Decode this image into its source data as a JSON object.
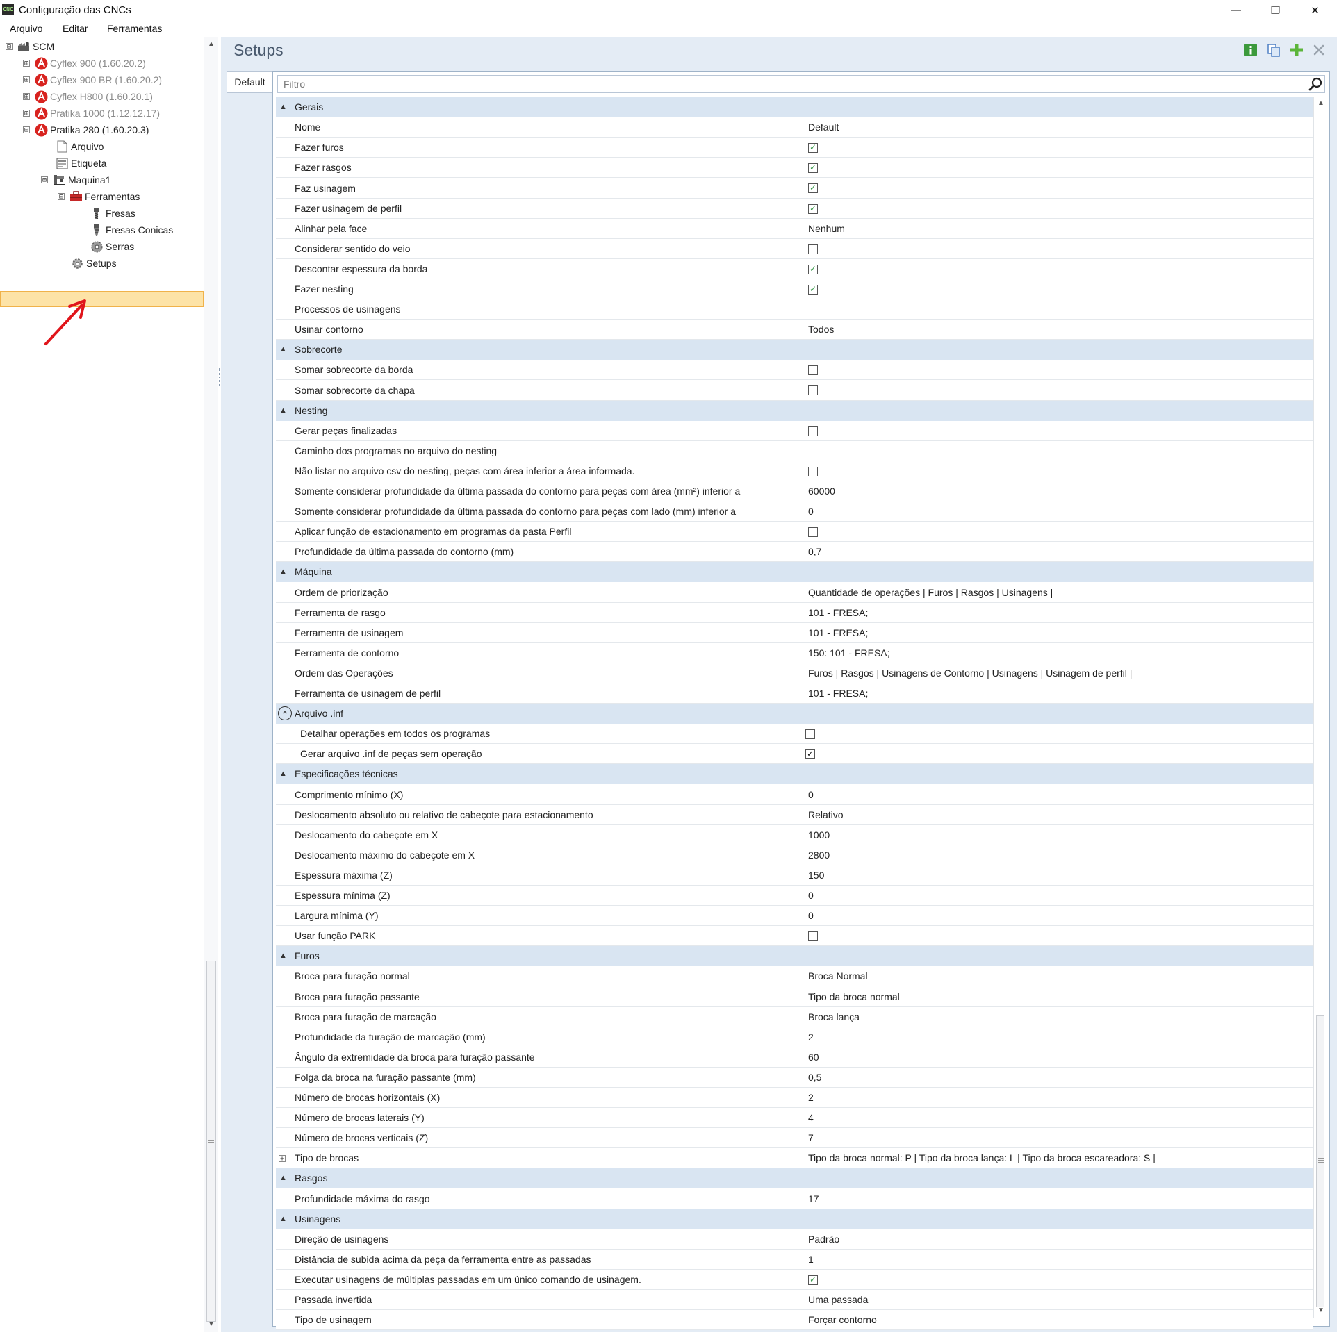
{
  "window": {
    "title": "Configuração das CNCs",
    "app_icon_text": "CNC",
    "minimize": "—",
    "restore": "❐",
    "close": "✕"
  },
  "menu": [
    "Arquivo",
    "Editar",
    "Ferramentas"
  ],
  "tree": [
    {
      "label": "SCM",
      "expander": "⊟",
      "icon": "factory-icon",
      "dim": false
    },
    {
      "label": "Cyflex 900 (1.60.20.2)",
      "expander": "⊞",
      "icon": "scm-logo-icon",
      "dim": true
    },
    {
      "label": "Cyflex 900 BR (1.60.20.2)",
      "expander": "⊞",
      "icon": "scm-logo-icon",
      "dim": true
    },
    {
      "label": "Cyflex H800 (1.60.20.1)",
      "expander": "⊞",
      "icon": "scm-logo-icon",
      "dim": true
    },
    {
      "label": "Pratika 1000 (1.12.12.17)",
      "expander": "⊞",
      "icon": "scm-logo-icon",
      "dim": true
    },
    {
      "label": "Pratika 280 (1.60.20.3)",
      "expander": "⊟",
      "icon": "scm-logo-icon",
      "dim": false
    },
    {
      "label": "Arquivo",
      "expander": "",
      "icon": "file-icon",
      "dim": false
    },
    {
      "label": "Etiqueta",
      "expander": "",
      "icon": "label-icon",
      "dim": false
    },
    {
      "label": "Maquina1",
      "expander": "⊟",
      "icon": "machine-icon",
      "dim": false
    },
    {
      "label": "Ferramentas",
      "expander": "⊟",
      "icon": "toolbox-icon",
      "dim": false
    },
    {
      "label": "Fresas",
      "expander": "",
      "icon": "mill-icon",
      "dim": false
    },
    {
      "label": "Fresas Conicas",
      "expander": "",
      "icon": "conic-mill-icon",
      "dim": false
    },
    {
      "label": "Serras",
      "expander": "",
      "icon": "saw-icon",
      "dim": false
    },
    {
      "label": "Setups",
      "expander": "",
      "icon": "gear-icon",
      "dim": false
    }
  ],
  "panel": {
    "title": "Setups",
    "tab": "Default",
    "filter_placeholder": "Filtro"
  },
  "colors": {
    "accent_selection": "#fde3a7",
    "category_bg": "#d9e5f2",
    "panel_bg": "#e4ecf5",
    "checkbox_tick": "#3a9a4a"
  },
  "grid": [
    {
      "type": "cat",
      "label": "Gerais",
      "toggle": "▲"
    },
    {
      "type": "prop",
      "name": "Nome",
      "value": "Default"
    },
    {
      "type": "prop",
      "name": "Fazer furos",
      "check": true
    },
    {
      "type": "prop",
      "name": "Fazer rasgos",
      "check": true
    },
    {
      "type": "prop",
      "name": "Faz usinagem",
      "check": true
    },
    {
      "type": "prop",
      "name": "Fazer usinagem de perfil",
      "check": true
    },
    {
      "type": "prop",
      "name": "Alinhar pela face",
      "value": "Nenhum"
    },
    {
      "type": "prop",
      "name": "Considerar sentido do veio",
      "check": false
    },
    {
      "type": "prop",
      "name": "Descontar espessura da borda",
      "check": true
    },
    {
      "type": "prop",
      "name": "Fazer nesting",
      "check": true
    },
    {
      "type": "prop",
      "name": "Processos de usinagens",
      "value": ""
    },
    {
      "type": "prop",
      "name": "Usinar contorno",
      "value": "Todos"
    },
    {
      "type": "cat",
      "label": "Sobrecorte",
      "toggle": "▲"
    },
    {
      "type": "prop",
      "name": "Somar sobrecorte da borda",
      "check": false
    },
    {
      "type": "prop",
      "name": "Somar sobrecorte da chapa",
      "check": false
    },
    {
      "type": "cat",
      "label": "Nesting",
      "toggle": "▲"
    },
    {
      "type": "prop",
      "name": "Gerar peças finalizadas",
      "check": false
    },
    {
      "type": "prop",
      "name": "Caminho dos programas no arquivo do nesting",
      "value": ""
    },
    {
      "type": "prop",
      "name": "Não listar no arquivo csv do nesting, peças com área inferior a área informada.",
      "check": false
    },
    {
      "type": "prop",
      "name": "Somente considerar profundidade da última passada do contorno para peças com área (mm²) inferior a",
      "value": "60000"
    },
    {
      "type": "prop",
      "name": "Somente considerar profundidade da última passada do contorno para peças com lado (mm) inferior a",
      "value": "0"
    },
    {
      "type": "prop",
      "name": "Aplicar função de estacionamento em programas da pasta Perfil",
      "check": false
    },
    {
      "type": "prop",
      "name": "Profundidade da última passada do contorno (mm)",
      "value": "0,7"
    },
    {
      "type": "cat",
      "label": "Máquina",
      "toggle": "▲"
    },
    {
      "type": "prop",
      "name": "Ordem de priorização",
      "value": "Quantidade de operações | Furos | Rasgos | Usinagens |"
    },
    {
      "type": "prop",
      "name": "Ferramenta de rasgo",
      "value": "101 - FRESA;"
    },
    {
      "type": "prop",
      "name": "Ferramenta de usinagem",
      "value": "101 - FRESA;"
    },
    {
      "type": "prop",
      "name": "Ferramenta de contorno",
      "value": "150: 101 - FRESA;"
    },
    {
      "type": "prop",
      "name": "Ordem das Operações",
      "value": "Furos | Rasgos | Usinagens de Contorno | Usinagens | Usinagem de perfil |"
    },
    {
      "type": "prop",
      "name": "Ferramenta de usinagem de perfil",
      "value": "101 - FRESA;"
    },
    {
      "type": "cat",
      "label": "Arquivo .inf",
      "toggle": "⌃",
      "circled": true
    },
    {
      "type": "prop",
      "name": "Detalhar operações em todos os programas",
      "check": false,
      "indent": true
    },
    {
      "type": "prop",
      "name": "Gerar arquivo .inf de peças sem operação",
      "check": true,
      "indent": true,
      "dark": true
    },
    {
      "type": "cat",
      "label": "Especificações técnicas",
      "toggle": "▲"
    },
    {
      "type": "prop",
      "name": "Comprimento mínimo (X)",
      "value": "0"
    },
    {
      "type": "prop",
      "name": "Deslocamento absoluto ou relativo de cabeçote para estacionamento",
      "value": "Relativo"
    },
    {
      "type": "prop",
      "name": "Deslocamento do cabeçote em X",
      "value": "1000"
    },
    {
      "type": "prop",
      "name": "Deslocamento máximo do cabeçote em X",
      "value": "2800"
    },
    {
      "type": "prop",
      "name": "Espessura máxima (Z)",
      "value": "150"
    },
    {
      "type": "prop",
      "name": "Espessura mínima (Z)",
      "value": "0"
    },
    {
      "type": "prop",
      "name": "Largura mínima (Y)",
      "value": "0"
    },
    {
      "type": "prop",
      "name": "Usar função PARK",
      "check": false
    },
    {
      "type": "cat",
      "label": "Furos",
      "toggle": "▲"
    },
    {
      "type": "prop",
      "name": "Broca para furação normal",
      "value": "Broca Normal"
    },
    {
      "type": "prop",
      "name": "Broca para furação passante",
      "value": "Tipo da broca normal"
    },
    {
      "type": "prop",
      "name": "Broca para furação de marcação",
      "value": "Broca lança"
    },
    {
      "type": "prop",
      "name": "Profundidade da furação de marcação (mm)",
      "value": "2"
    },
    {
      "type": "prop",
      "name": "Ângulo da extremidade da broca para furação passante",
      "value": "60"
    },
    {
      "type": "prop",
      "name": "Folga da broca na furação passante (mm)",
      "value": "0,5"
    },
    {
      "type": "prop",
      "name": "Número de brocas horizontais (X)",
      "value": "2"
    },
    {
      "type": "prop",
      "name": "Número de brocas laterais (Y)",
      "value": "4"
    },
    {
      "type": "prop",
      "name": "Número de brocas verticais (Z)",
      "value": "7"
    },
    {
      "type": "prop",
      "name": "Tipo de brocas",
      "value": "Tipo da broca normal: P  |  Tipo da broca lança: L  |  Tipo da broca escareadora: S  |",
      "expandable": true
    },
    {
      "type": "cat",
      "label": "Rasgos",
      "toggle": "▲"
    },
    {
      "type": "prop",
      "name": "Profundidade máxima do rasgo",
      "value": "17"
    },
    {
      "type": "cat",
      "label": "Usinagens",
      "toggle": "▲"
    },
    {
      "type": "prop",
      "name": "Direção de usinagens",
      "value": "Padrão"
    },
    {
      "type": "prop",
      "name": "Distância de subida acima da peça da ferramenta entre as passadas",
      "value": "1"
    },
    {
      "type": "prop",
      "name": "Executar usinagens de múltiplas passadas em um único comando de usinagem.",
      "check": true
    },
    {
      "type": "prop",
      "name": "Passada invertida",
      "value": "Uma passada"
    },
    {
      "type": "prop",
      "name": "Tipo de usinagem",
      "value": "Forçar contorno"
    }
  ]
}
